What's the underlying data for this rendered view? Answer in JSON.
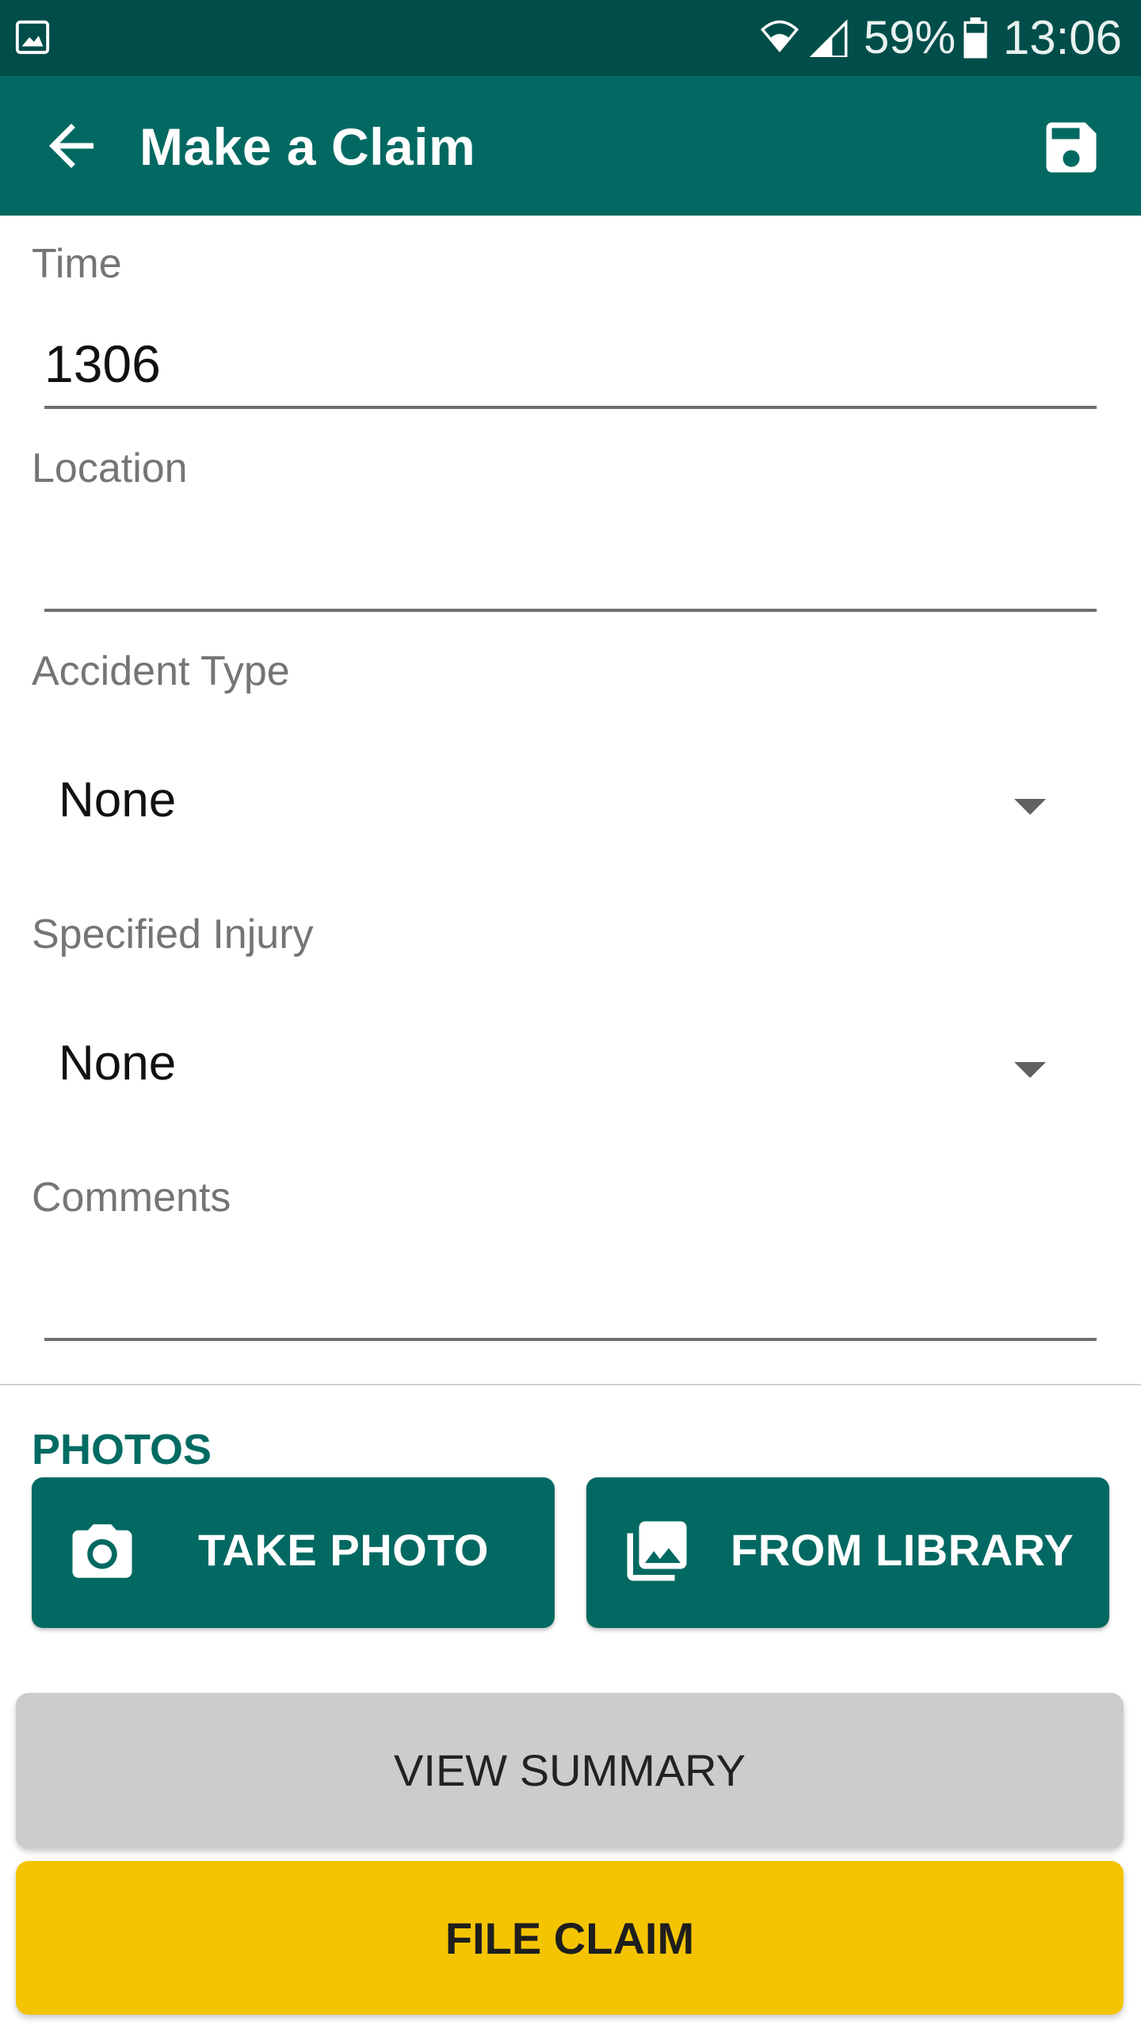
{
  "status_bar": {
    "battery": "59%",
    "time": "13:06",
    "icons": [
      "gallery-icon",
      "wifi-icon",
      "signal-icon",
      "battery-icon"
    ]
  },
  "app_bar": {
    "title": "Make a Claim",
    "back_icon": "arrow-back-icon",
    "save_icon": "save-icon",
    "color": "#026962"
  },
  "form": {
    "time": {
      "label": "Time",
      "value": "1306"
    },
    "location": {
      "label": "Location",
      "value": ""
    },
    "accident_type": {
      "label": "Accident Type",
      "selected": "None"
    },
    "specified_injury": {
      "label": "Specified Injury",
      "selected": "None"
    },
    "comments": {
      "label": "Comments",
      "value": ""
    }
  },
  "photos": {
    "section_title": "PHOTOS",
    "take_photo_label": "TAKE PHOTO",
    "from_library_label": "FROM LIBRARY",
    "button_color": "#026962"
  },
  "actions": {
    "view_summary_label": "VIEW SUMMARY",
    "file_claim_label": "FILE CLAIM",
    "view_summary_color": "#cccccc",
    "file_claim_color": "#f5c400"
  }
}
